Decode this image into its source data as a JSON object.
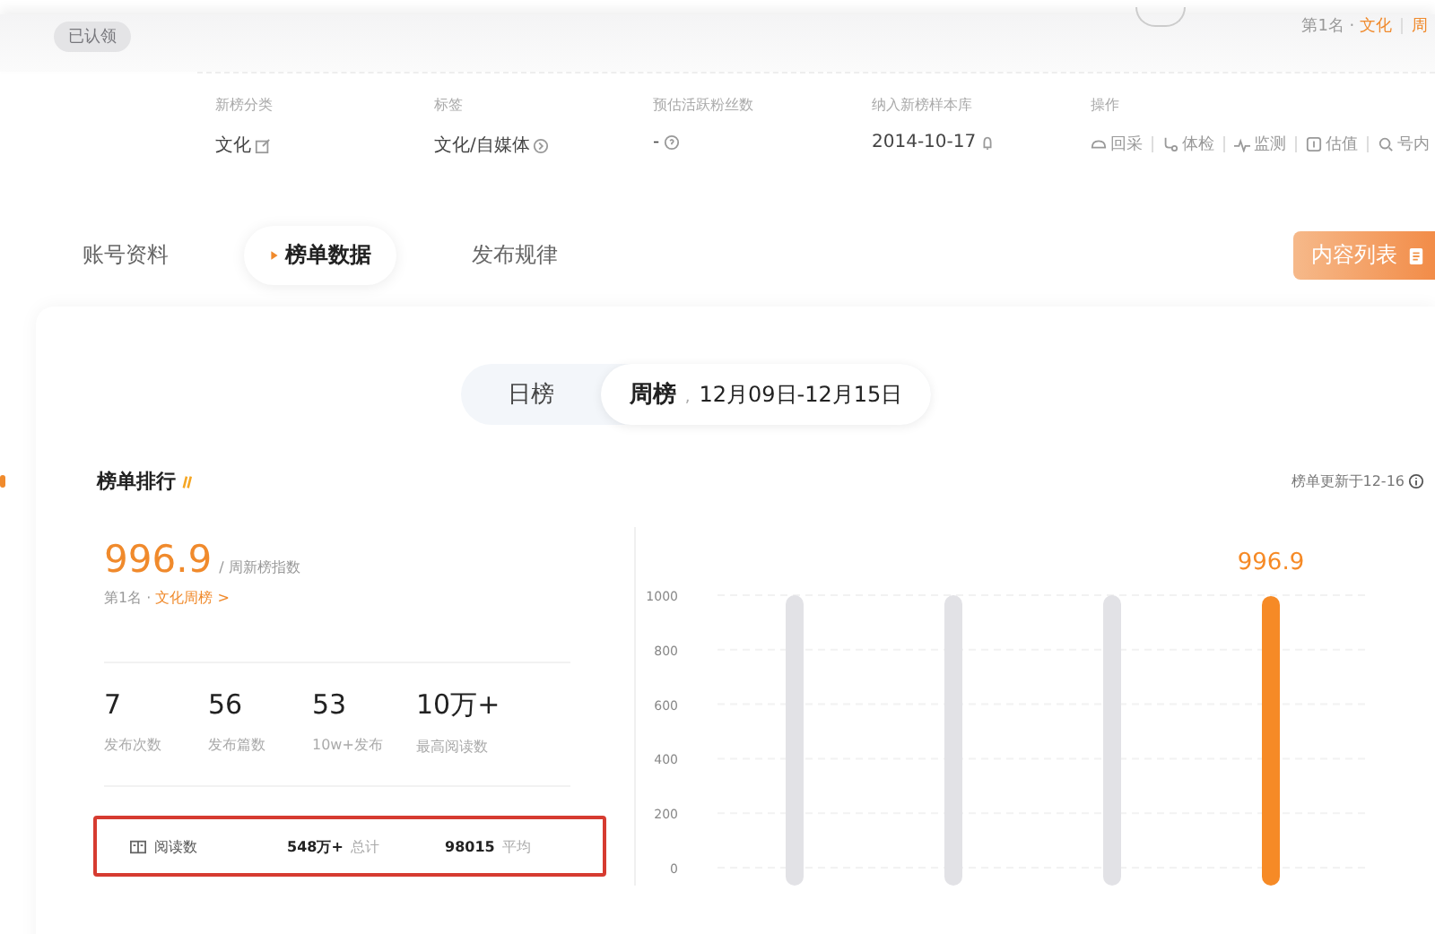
{
  "header": {
    "claim_badge": "已认领",
    "rank_prefix": "第1名 · ",
    "rank_links": [
      "文化",
      "周"
    ]
  },
  "info_columns": [
    {
      "kind": "text",
      "label": "新榜分类",
      "value": "文化"
    },
    {
      "kind": "text",
      "label": "标签",
      "value": "文化/自媒体"
    },
    {
      "kind": "text",
      "label": "预估活跃粉丝数",
      "value": "-"
    },
    {
      "kind": "text",
      "label": "纳入新榜样本库",
      "value": "2014-10-17"
    },
    {
      "kind": "actions",
      "label": "操作",
      "actions": [
        "回采",
        "体检",
        "监测",
        "估值",
        "号内"
      ]
    }
  ],
  "tabs": [
    {
      "label": "账号资料",
      "selected": false
    },
    {
      "label": "榜单数据",
      "selected": true
    },
    {
      "label": "发布规律",
      "selected": false
    }
  ],
  "content_list_button": "内容列表",
  "period_toggle": [
    {
      "label": "日榜",
      "selected": false
    },
    {
      "label": "周榜",
      "separator": ",",
      "range": "12月09日-12月15日",
      "selected": true
    }
  ],
  "section": {
    "title": "榜单排行",
    "updated": "榜单更新于12-16"
  },
  "index": {
    "value": "996.9",
    "label": "/ 周新榜指数",
    "rank_prefix": "第1名 · ",
    "rank_link": "文化周榜 >"
  },
  "stats": [
    {
      "value": "7",
      "label": "发布次数"
    },
    {
      "value": "56",
      "label": "发布篇数"
    },
    {
      "value": "53",
      "label": "10w+发布"
    },
    {
      "value": "10万+",
      "label": "最高阅读数"
    }
  ],
  "reads": {
    "label": "阅读数",
    "total": "548万+",
    "total_label": "总计",
    "average": "98015",
    "average_label": "平均"
  },
  "chart_data": {
    "type": "bar",
    "series": [
      {
        "color": "#f68a26",
        "values": [
          null,
          null,
          null,
          996.9
        ]
      },
      {
        "color": "#e2e2e6",
        "values": [
          1000,
          1000,
          1000,
          null
        ]
      }
    ],
    "ylim": [
      0,
      1000
    ],
    "yticks": [
      0,
      200,
      400,
      600,
      800,
      1000
    ],
    "value_labels": [
      [
        null,
        null,
        null,
        "996.9"
      ],
      [
        null,
        null,
        null,
        null
      ]
    ],
    "grid": true
  }
}
